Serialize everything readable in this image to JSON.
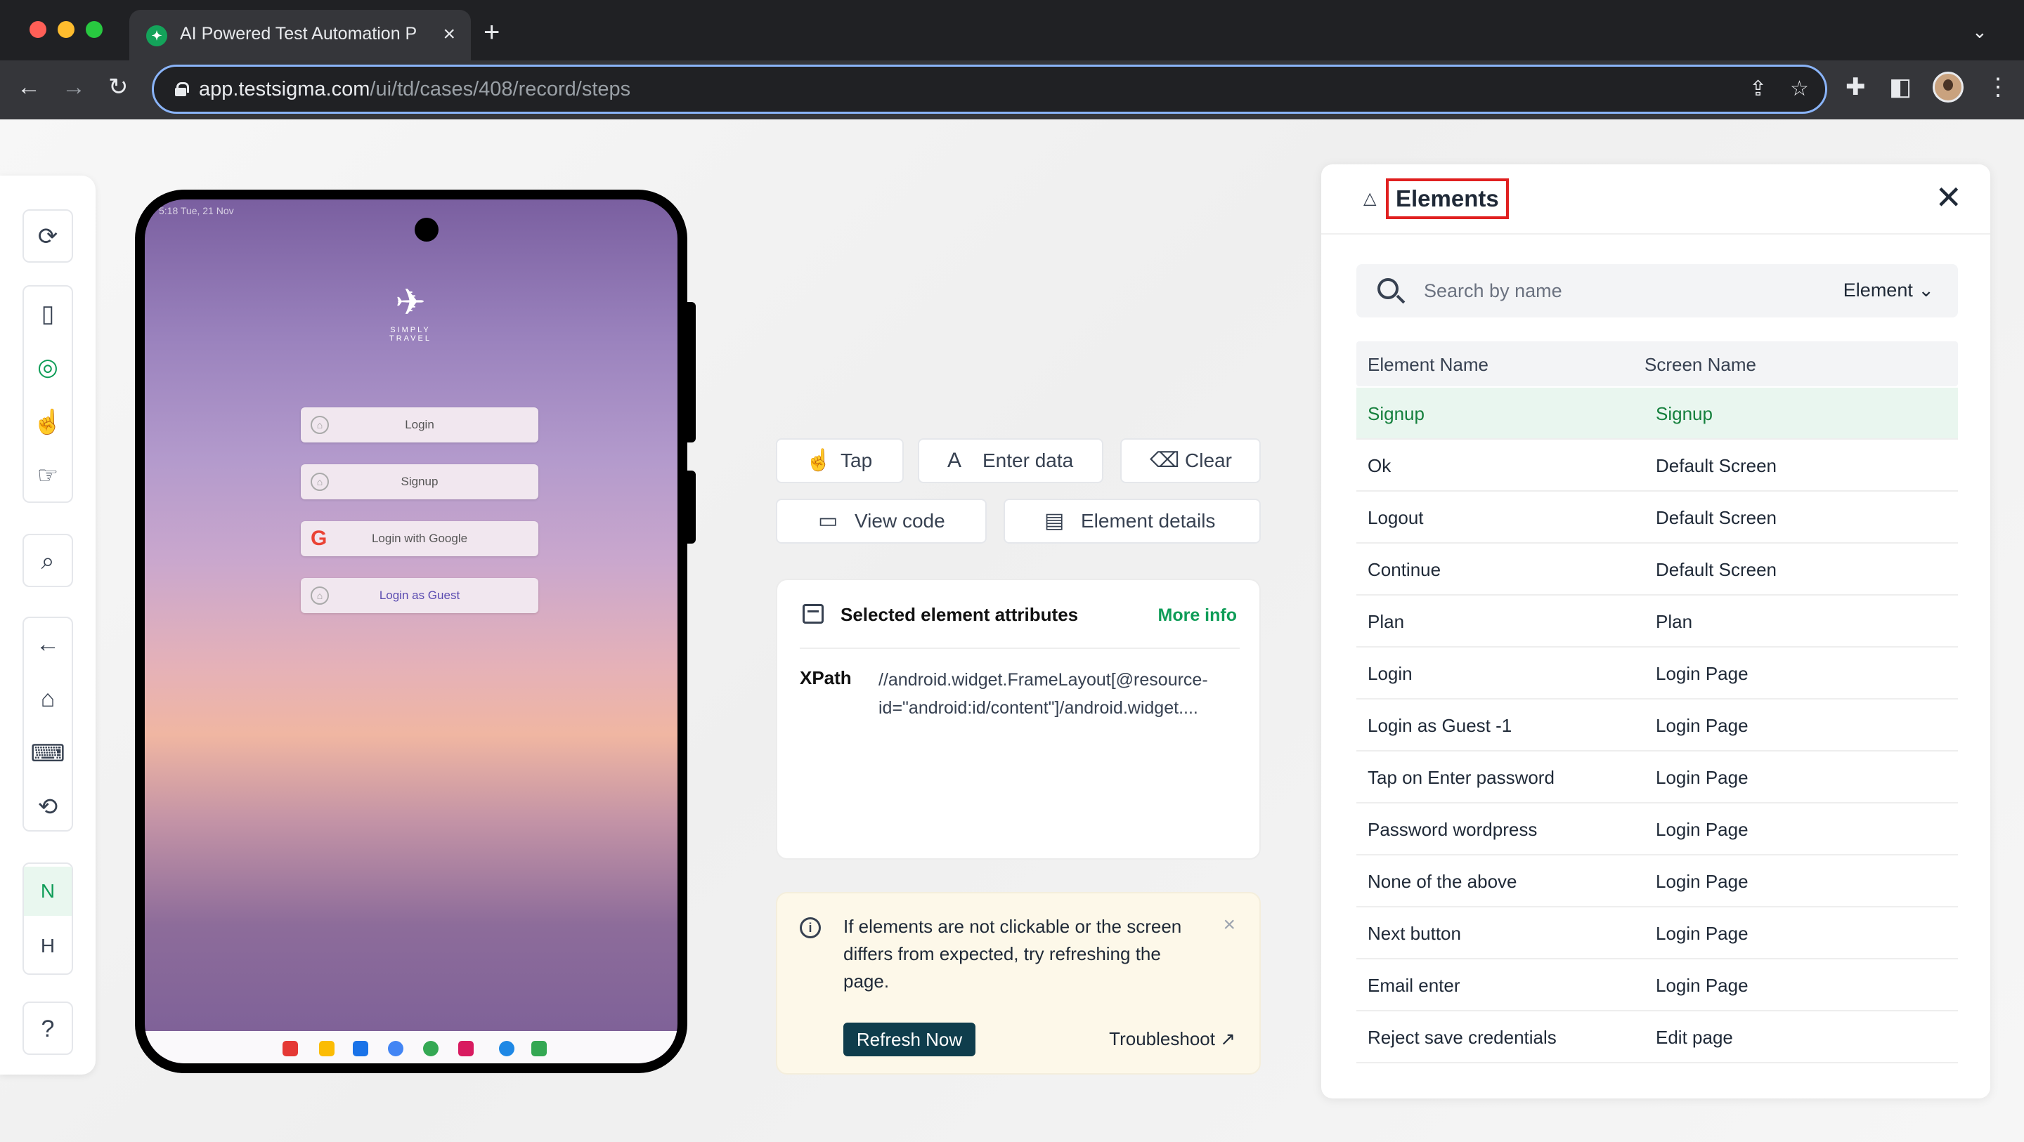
{
  "browser": {
    "tab_title": "AI Powered Test Automation P",
    "url_host": "app.testsigma.com",
    "url_path": "/ui/td/cases/408/record/steps",
    "new_tab": "+",
    "tab_close": "×"
  },
  "toolbar": {
    "letter_n": "N",
    "letter_h": "H"
  },
  "device": {
    "status": "5:18  Tue, 21 Nov",
    "logo_text": "SIMPLY TRAVEL",
    "buttons": [
      {
        "label": "Login"
      },
      {
        "label": "Signup"
      },
      {
        "label": "Login with Google"
      },
      {
        "label": "Login as Guest"
      }
    ]
  },
  "actions": {
    "tap": "Tap",
    "enter_data": "Enter data",
    "clear": "Clear",
    "view_code": "View code",
    "element_details": "Element details"
  },
  "attributes": {
    "title": "Selected element attributes",
    "more_info": "More info",
    "xpath_label": "XPath",
    "xpath_value": "//android.widget.FrameLayout[@resource-id=\"android:id/content\"]/android.widget...."
  },
  "notice": {
    "text": "If elements are not clickable or the screen differs from expected, try refreshing the page.",
    "refresh": "Refresh Now",
    "troubleshoot": "Troubleshoot"
  },
  "elements_panel": {
    "title": "Elements",
    "search_placeholder": "Search by name",
    "filter": "Element",
    "columns": {
      "name": "Element Name",
      "screen": "Screen Name"
    },
    "rows": [
      {
        "name": "Signup",
        "screen": "Signup",
        "selected": true
      },
      {
        "name": "Ok",
        "screen": "Default Screen"
      },
      {
        "name": "Logout",
        "screen": "Default Screen"
      },
      {
        "name": "Continue",
        "screen": "Default Screen"
      },
      {
        "name": "Plan",
        "screen": "Plan"
      },
      {
        "name": "Login",
        "screen": "Login Page"
      },
      {
        "name": "Login as Guest -1",
        "screen": "Login Page"
      },
      {
        "name": "Tap on Enter password",
        "screen": "Login Page"
      },
      {
        "name": "Password wordpress",
        "screen": "Login Page"
      },
      {
        "name": "None of the above",
        "screen": "Login Page"
      },
      {
        "name": "Next button",
        "screen": "Login Page"
      },
      {
        "name": "Email enter",
        "screen": "Login Page"
      },
      {
        "name": "Reject save credentials",
        "screen": "Edit page"
      }
    ]
  },
  "colors": {
    "accent": "#0f9d58",
    "highlight_box": "#e02020",
    "refresh_bg": "#0f3d4c"
  }
}
